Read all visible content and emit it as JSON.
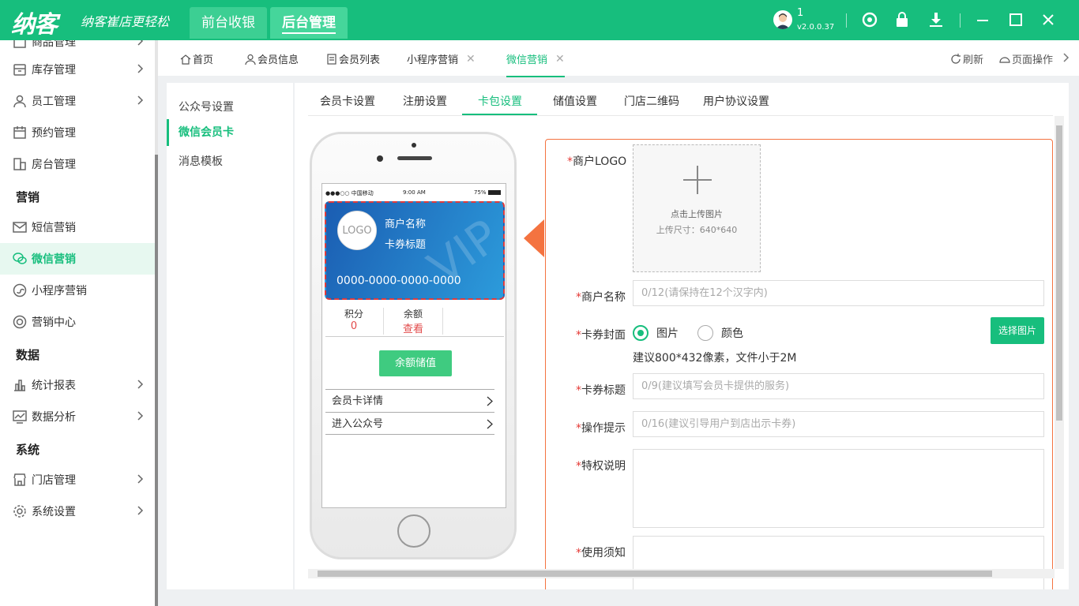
{
  "app": {
    "logo": "纳客",
    "slogan": "纳客崔店更轻松",
    "user": "1",
    "version": "v2.0.0.37"
  },
  "mode_tabs": [
    "前台收银",
    "后台管理"
  ],
  "sidebar": {
    "partial_top": "商品管理",
    "items": [
      {
        "label": "库存管理",
        "icon": "inventory-icon"
      },
      {
        "label": "员工管理",
        "icon": "user-icon"
      },
      {
        "label": "预约管理",
        "icon": "calendar-icon"
      },
      {
        "label": "房台管理",
        "icon": "building-icon"
      }
    ],
    "group_marketing": "营销",
    "marketing": [
      {
        "label": "短信营销",
        "icon": "mail-icon"
      },
      {
        "label": "微信营销",
        "icon": "wechat-icon"
      },
      {
        "label": "小程序营销",
        "icon": "miniprogram-icon"
      },
      {
        "label": "营销中心",
        "icon": "target-icon"
      }
    ],
    "group_data": "数据",
    "data": [
      {
        "label": "统计报表",
        "icon": "bar-chart-icon"
      },
      {
        "label": "数据分析",
        "icon": "line-chart-icon"
      }
    ],
    "group_system": "系统",
    "system": [
      {
        "label": "门店管理",
        "icon": "store-icon"
      },
      {
        "label": "系统设置",
        "icon": "gear-icon"
      }
    ]
  },
  "tabbar": {
    "tabs": [
      "首页",
      "会员信息",
      "会员列表",
      "小程序营销",
      "微信营销"
    ],
    "refresh": "刷新",
    "page_ops": "页面操作"
  },
  "subnav": [
    "公众号设置",
    "微信会员卡",
    "消息模板"
  ],
  "content_tabs": [
    "会员卡设置",
    "注册设置",
    "卡包设置",
    "储值设置",
    "门店二维码",
    "用户协议设置"
  ],
  "phone": {
    "carrier": "●●●○○ 中国移动",
    "time": "9:00 AM",
    "battery": "75%",
    "logo": "LOGO",
    "merchant": "商户名称",
    "card_title": "卡券标题",
    "card_no": "0000-0000-0000-0000",
    "watermark": "VIP",
    "points_label": "积分",
    "points_value": "0",
    "balance_label": "余额",
    "balance_value": "查看",
    "recharge": "余额储值",
    "row1": "会员卡详情",
    "row2": "进入公众号"
  },
  "form": {
    "logo_label": "商户LOGO",
    "upload_text": "点击上传图片",
    "upload_size": "上传尺寸：640*640",
    "name_label": "商户名称",
    "name_ph": "0/12(请保持在12个汉字内)",
    "cover_label": "卡券封面",
    "cover_opt1": "图片",
    "cover_opt2": "颜色",
    "select_btn": "选择图片",
    "cover_hint": "建议800*432像素，文件小于2M",
    "title_label": "卡券标题",
    "title_ph": "0/9(建议填写会员卡提供的服务)",
    "tip_label": "操作提示",
    "tip_ph": "0/16(建议引导用户到店出示卡券)",
    "priv_label": "特权说明",
    "notice_label": "使用须知",
    "required": "*"
  },
  "colors": {
    "brand": "#17be7d",
    "accent": "#f47340",
    "required": "#e53935"
  }
}
